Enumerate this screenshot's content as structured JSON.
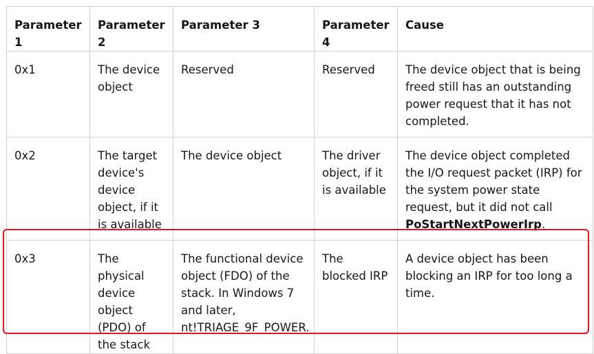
{
  "headers": [
    "Parameter 1",
    "Parameter 2",
    "Parameter 3",
    "Parameter 4",
    "Cause"
  ],
  "rows": [
    {
      "p1": "0x1",
      "p2": "The device object",
      "p3": "Reserved",
      "p4": "Reserved",
      "cause": "The device object that is being freed still has an outstanding power request that it has not completed."
    },
    {
      "p1": "0x2",
      "p2": "The target device's device object, if it is available",
      "p3": "The device object",
      "p4": "The driver object, if it is available",
      "cause_prefix": "The device object completed the I/O request packet (IRP) for the system power state request, but it did not call ",
      "cause_bold": "PoStartNextPowerIrp",
      "cause_suffix": "."
    },
    {
      "p1": "0x3",
      "p2": "The physical device object (PDO) of the stack",
      "p3": "The functional device object (FDO) of the stack. In Windows 7 and later, nt!TRIAGE_9F_POWER.",
      "p4": "The blocked IRP",
      "cause": "A device object has been blocking an IRP for too long a time."
    }
  ],
  "colors": {
    "highlight": "#e0161b",
    "border": "#cfcfcf",
    "text": "#171717"
  }
}
